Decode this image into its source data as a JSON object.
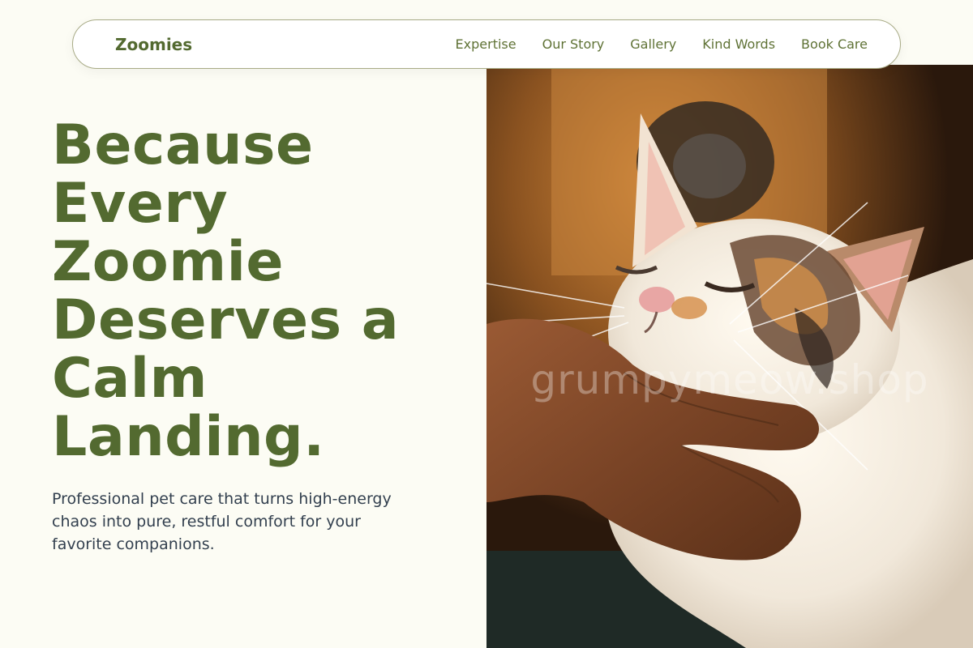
{
  "nav": {
    "brand": "Zoomies",
    "links": [
      "Expertise",
      "Our Story",
      "Gallery",
      "Kind Words",
      "Book Care"
    ]
  },
  "hero": {
    "title": "Because Every Zoomie Deserves a Calm Landing.",
    "subtitle": "Professional pet care that turns high-energy chaos into pure, restful comfort for your favorite companions.",
    "watermark": "grumpymeow.shop"
  },
  "colors": {
    "page_bg": "#fcfcf4",
    "accent_green": "#536a30",
    "nav_border": "#a8ab86",
    "body_text": "#33404f"
  }
}
